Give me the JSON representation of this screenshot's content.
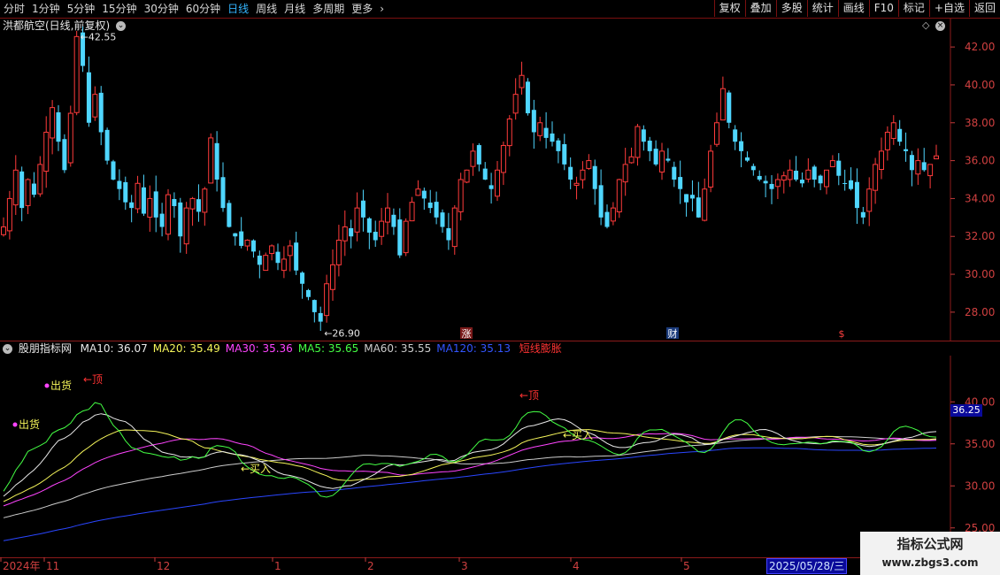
{
  "toolbar": {
    "periods": [
      "分时",
      "1分钟",
      "5分钟",
      "15分钟",
      "30分钟",
      "60分钟",
      "日线",
      "周线",
      "月线",
      "多周期",
      "更多"
    ],
    "more_icon": "chevron-right-icon",
    "active_period": "日线",
    "right_buttons": [
      "复权",
      "叠加",
      "多股",
      "统计",
      "画线",
      "F10",
      "标记",
      "+自选",
      "返回"
    ]
  },
  "main_chart": {
    "title": "洪都航空(日线,前复权)",
    "high_label": "42.55",
    "low_label": "26.90",
    "y_ticks": [
      "42.00",
      "40.00",
      "38.00",
      "36.00",
      "34.00",
      "32.00",
      "30.00",
      "28.00"
    ],
    "event_markers": [
      "涨",
      "财",
      "$"
    ]
  },
  "indicator": {
    "name": "股朋指标网",
    "legend": [
      {
        "label": "MA10: 36.07",
        "color": "#e8e8e8"
      },
      {
        "label": "MA20: 35.49",
        "color": "#f5f55a"
      },
      {
        "label": "MA30: 35.36",
        "color": "#ff44ff"
      },
      {
        "label": "MA5: 35.65",
        "color": "#44ff44"
      },
      {
        "label": "MA60: 35.55",
        "color": "#cccccc"
      },
      {
        "label": "MA120: 35.13",
        "color": "#3355ff"
      }
    ],
    "signal_label": "短线膨胀",
    "signal_color": "#ff3333",
    "y_ticks": [
      "40.00",
      "35.00",
      "30.00",
      "25.00"
    ],
    "highlight_value": "36.25",
    "annotations": {
      "sell_1": "出货",
      "sell_2": "出货",
      "buy_1": "买入",
      "buy_2": "买入",
      "top_1": "←顶",
      "top_2": "←顶"
    }
  },
  "x_axis": {
    "labels": [
      "2024年",
      "11",
      "12",
      "1",
      "2",
      "3",
      "4",
      "5"
    ],
    "selected_date": "2025/05/28/三"
  },
  "watermark": {
    "title": "指标公式网",
    "url": "www.zbgs3.com"
  },
  "chart_data": {
    "type": "candlestick",
    "price_range": [
      26.9,
      42.55
    ],
    "ylim": [
      26.5,
      43.5
    ],
    "candles_approx_close": [
      32.5,
      34.0,
      35.5,
      33.5,
      35.0,
      34.2,
      35.8,
      37.5,
      38.8,
      37.0,
      35.5,
      38.5,
      42.55,
      41.0,
      38.0,
      39.5,
      37.5,
      36.0,
      35.0,
      34.5,
      33.8,
      33.5,
      34.8,
      33.2,
      34.0,
      33.0,
      32.5,
      34.2,
      33.6,
      32.0,
      33.5,
      34.0,
      33.3,
      34.5,
      37.2,
      35.0,
      33.5,
      32.5,
      32.0,
      31.5,
      31.8,
      31.2,
      30.5,
      31.0,
      31.5,
      30.6,
      30.8,
      31.5,
      30.2,
      29.5,
      28.8,
      28.0,
      27.5,
      29.5,
      30.5,
      31.8,
      32.5,
      32.0,
      33.5,
      33.0,
      32.2,
      31.8,
      32.8,
      33.5,
      32.5,
      31.0,
      32.8,
      33.8,
      34.5,
      34.0,
      33.5,
      33.0,
      32.5,
      31.8,
      33.5,
      35.0,
      35.5,
      36.5,
      35.8,
      35.0,
      34.5,
      35.5,
      36.8,
      38.2,
      39.5,
      40.5,
      38.5,
      37.5,
      38.0,
      37.2,
      37.0,
      36.5,
      35.8,
      35.0,
      34.8,
      35.5,
      36.0,
      34.5,
      33.0,
      32.5,
      33.5,
      35.0,
      35.8,
      36.2,
      37.8,
      37.0,
      36.5,
      35.8,
      36.5,
      36.0,
      35.0,
      34.5,
      33.8,
      34.0,
      33.0,
      34.5,
      36.5,
      38.0,
      39.8,
      38.0,
      37.0,
      36.5,
      36.0,
      35.5,
      35.0,
      34.8,
      34.5,
      35.0,
      35.2,
      35.5,
      35.0,
      34.8,
      35.5,
      35.0,
      34.8,
      35.5,
      36.0,
      35.2,
      34.8,
      34.5,
      33.5,
      33.0,
      34.5,
      35.8,
      36.5,
      37.5,
      38.0,
      37.0,
      36.5,
      35.5,
      36.0,
      35.5,
      35.8,
      36.25
    ],
    "x_labels": [
      "2024年",
      "11",
      "12",
      "1",
      "2",
      "3",
      "4",
      "5"
    ],
    "indicator_lines": [
      {
        "name": "MA10",
        "last": 36.07
      },
      {
        "name": "MA20",
        "last": 35.49
      },
      {
        "name": "MA30",
        "last": 35.36
      },
      {
        "name": "MA5",
        "last": 35.65
      },
      {
        "name": "MA60",
        "last": 35.55
      },
      {
        "name": "MA120",
        "last": 35.13
      }
    ]
  }
}
